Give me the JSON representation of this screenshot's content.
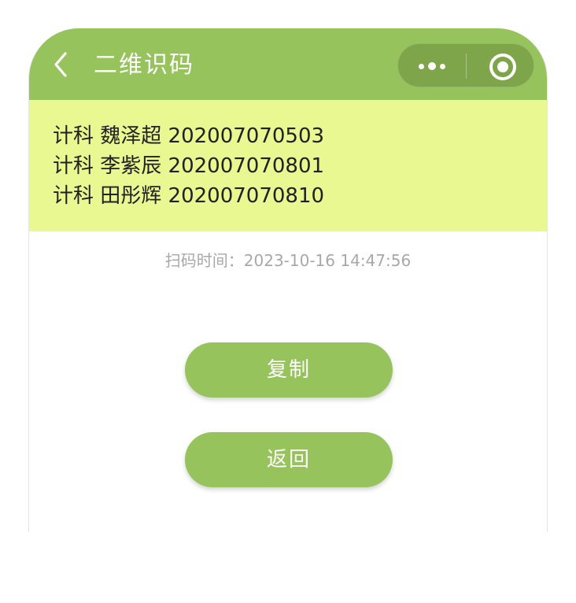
{
  "navbar": {
    "title": "二维识码",
    "back_icon": "chevron-left-icon",
    "more_icon": "more-dots-icon",
    "close_icon": "circle-target-icon",
    "background_color": "#97c35c"
  },
  "result": {
    "background_color": "#e9f891",
    "lines": [
      "计科 魏泽超 202007070503",
      "计科 李紫辰 202007070801",
      "计科 田彤辉 202007070810"
    ]
  },
  "scan_time": {
    "text": "扫码时间：2023-10-16 14:47:56"
  },
  "buttons": {
    "copy_label": "复制",
    "back_label": "返回",
    "color": "#97c35c"
  }
}
